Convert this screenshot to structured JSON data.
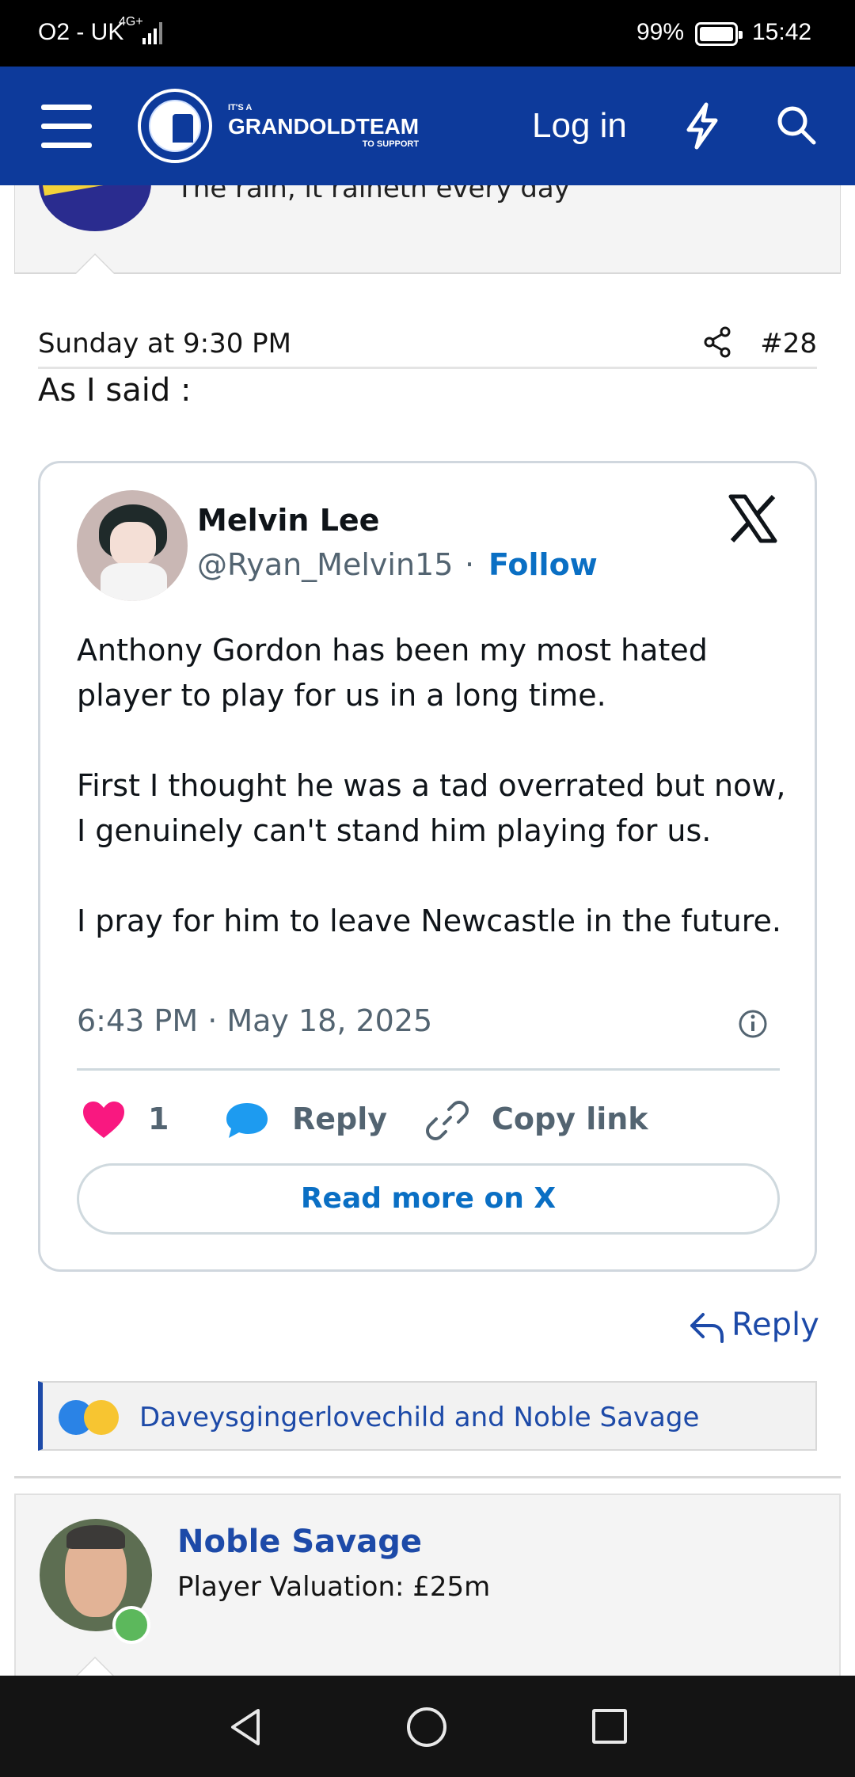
{
  "status_bar": {
    "carrier": "O2 - UK",
    "network": "4G+",
    "battery": "99%",
    "time": "15:42"
  },
  "header": {
    "logo_small": "IT'S A",
    "logo_big": "GRANDOLDTEAM",
    "logo_sub": "TO SUPPORT",
    "login_label": "Log in",
    "icons": [
      "menu-icon",
      "bolt-icon",
      "search-icon"
    ]
  },
  "previous_post": {
    "signature": "The rain, it raineth every day"
  },
  "post": {
    "date": "Sunday at 9:30 PM",
    "number": "#28",
    "text": "As I said :",
    "reply_label": "Reply",
    "reactions_text": "Daveysgingerlovechild and Noble Savage"
  },
  "tweet": {
    "name": "Melvin Lee",
    "handle": "@Ryan_Melvin15",
    "separator": "·",
    "follow_label": "Follow",
    "paragraphs": [
      "Anthony Gordon has been my most hated player to play for us in a long time.",
      "First I thought he was a tad overrated but now, I genuinely can't stand him playing for us.",
      "I pray for him to leave Newcastle in the future."
    ],
    "timestamp": "6:43 PM · May 18, 2025",
    "likes": "1",
    "reply_label": "Reply",
    "copy_label": "Copy link",
    "read_more_label": "Read more on X",
    "colors": {
      "follow": "#0a6fc4",
      "heart": "#f91880",
      "bubble": "#1d9bf0"
    }
  },
  "next_post": {
    "author": "Noble Savage",
    "user_title": "Player Valuation: £25m"
  },
  "theme": {
    "header_bg": "#0d3a9b",
    "link": "#1d4aa8"
  }
}
